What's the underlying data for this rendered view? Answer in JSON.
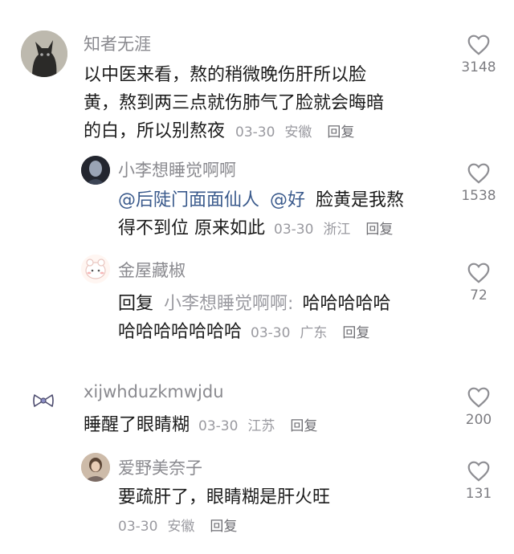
{
  "comments": [
    {
      "username": "知者无涯",
      "line1": "以中医来看，熬的稍微晚伤肝所以脸",
      "line2": "黄，熬到两三点就伤肺气了脸就会晦暗",
      "line3": "的白，所以别熬夜",
      "date": "03-30",
      "location": "安徽",
      "reply_label": "回复",
      "likes": "3148",
      "replies": [
        {
          "username": "小李想睡觉啊啊",
          "mention1": "@后陡门面面仙人",
          "mention2": "@好",
          "text_a": "脸黄是我熬",
          "text_b": "得不到位 原来如此",
          "date": "03-30",
          "location": "浙江",
          "reply_label": "回复",
          "likes": "1538"
        },
        {
          "username": "金屋藏椒",
          "prefix": "回复",
          "target": "小李想睡觉啊啊:",
          "text_a": "哈哈哈哈哈",
          "text_b": "哈哈哈哈哈哈哈",
          "date": "03-30",
          "location": "广东",
          "reply_label": "回复",
          "likes": "72"
        }
      ]
    },
    {
      "username": "xijwhduzkmwjdu",
      "text": "睡醒了眼睛糊",
      "date": "03-30",
      "location": "江苏",
      "reply_label": "回复",
      "likes": "200",
      "replies": [
        {
          "username": "爱野美奈子",
          "text": "要疏肝了，眼睛糊是肝火旺",
          "date": "03-30",
          "location": "安徽",
          "reply_label": "回复",
          "likes": "131"
        }
      ]
    }
  ]
}
